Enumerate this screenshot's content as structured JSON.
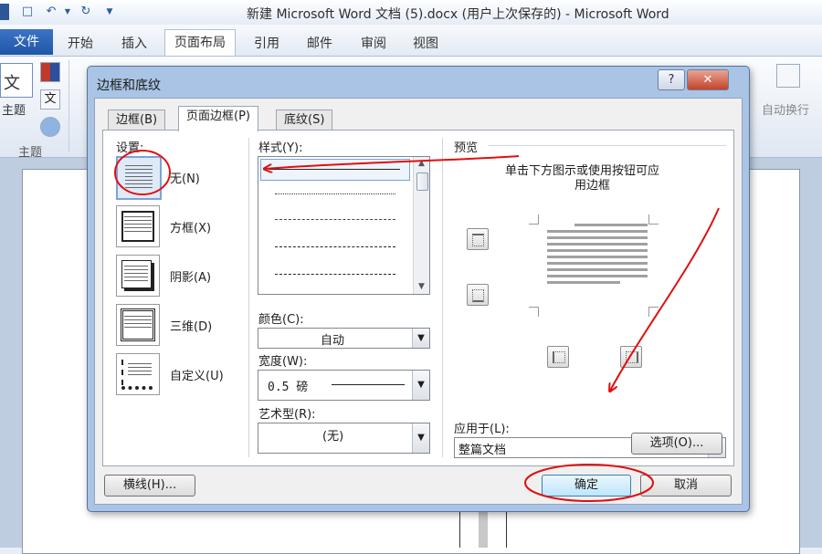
{
  "window": {
    "title": "新建 Microsoft Word 文档 (5).docx (用户上次保存的) - Microsoft Word",
    "quick_access": [
      "save-icon",
      "undo-icon",
      "redo-icon",
      "customize-icon"
    ]
  },
  "ribbon": {
    "file_tab": "文件",
    "tabs": [
      "开始",
      "插入",
      "页面布局",
      "引用",
      "邮件",
      "审阅",
      "视图"
    ],
    "active_tab": "页面布局",
    "theme_group": {
      "button_label": "主题",
      "icon_text": "文",
      "group_label": "主题"
    },
    "auto_wrap_label": "自动换行"
  },
  "dialog": {
    "title": "边框和底纹",
    "help_button": "?",
    "close_button": "✕",
    "tabs": [
      "边框(B)",
      "页面边框(P)",
      "底纹(S)"
    ],
    "active_tab": "页面边框(P)",
    "settings": {
      "label": "设置:",
      "options": [
        "无(N)",
        "方框(X)",
        "阴影(A)",
        "三维(D)",
        "自定义(U)"
      ],
      "selected": "无(N)"
    },
    "style": {
      "label": "样式(Y):",
      "options": [
        "solid",
        "dotted-fine",
        "dashed-fine",
        "dashed",
        "dash-dot"
      ]
    },
    "color": {
      "label": "颜色(C):",
      "value": "自动"
    },
    "width": {
      "label": "宽度(W):",
      "value": "0.5 磅"
    },
    "art": {
      "label": "艺术型(R):",
      "value": "(无)"
    },
    "preview": {
      "label": "预览",
      "hint_line1": "单击下方图示或使用按钮可应",
      "hint_line2": "用边框"
    },
    "apply_to": {
      "label": "应用于(L):",
      "value": "整篇文档"
    },
    "options_button": "选项(O)...",
    "horizontal_line_button": "横线(H)...",
    "ok_button": "确定",
    "cancel_button": "取消"
  },
  "colors": {
    "annotation": "#e01010",
    "file_tab": "#2a5fb0",
    "dialog_frame": "#a9c4e5"
  }
}
